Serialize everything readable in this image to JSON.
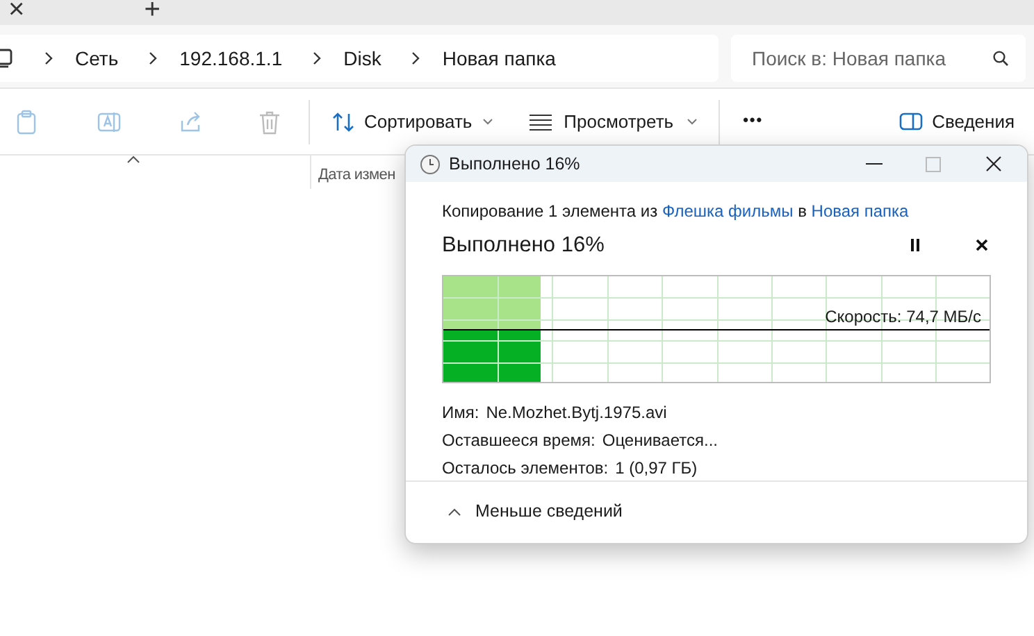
{
  "tab_strip": {
    "close": "×",
    "new_tab": "+"
  },
  "breadcrumbs": [
    "Сеть",
    "192.168.1.1",
    "Disk",
    "Новая папка"
  ],
  "search": {
    "placeholder": "Поиск в: Новая папка"
  },
  "toolbar": {
    "sort": "Сортировать",
    "view": "Просмотреть",
    "more": "•••",
    "details": "Сведения"
  },
  "column_header": {
    "label": "Дата измен"
  },
  "dialog": {
    "title": "Выполнено 16%",
    "description": [
      {
        "text": "Копирование 1 элемента из ",
        "link": false
      },
      {
        "text": "Флешка фильмы",
        "link": true
      },
      {
        "text": " в ",
        "link": false
      },
      {
        "text": "Новая папка",
        "link": true
      }
    ],
    "heading": "Выполнено 16%",
    "speed": "Скорость: 74,7 МБ/с",
    "details": [
      {
        "label": "Имя:",
        "value": "Ne.Mozhet.Bytj.1975.avi"
      },
      {
        "label": "Оставшееся время:",
        "value": "Оценивается..."
      },
      {
        "label": "Осталось элементов:",
        "value": "1 (0,97 ГБ)"
      }
    ],
    "toggle": "Меньше сведений"
  }
}
